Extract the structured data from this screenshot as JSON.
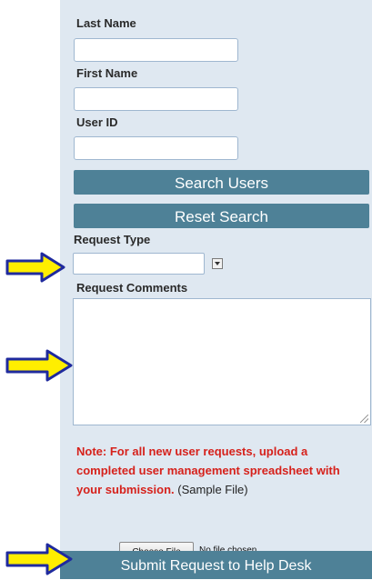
{
  "form": {
    "last_name_label": "Last Name",
    "last_name_value": "",
    "first_name_label": "First Name",
    "first_name_value": "",
    "user_id_label": "User ID",
    "user_id_value": "",
    "search_users_label": "Search Users",
    "reset_search_label": "Reset Search",
    "request_type_label": "Request Type",
    "request_type_value": "",
    "request_comments_label": "Request Comments",
    "request_comments_value": "",
    "note_text": "Note: For all new user requests, upload a completed user management spreadsheet with your submission.",
    "sample_link_text": "(Sample File)",
    "choose_file_label": "Choose File",
    "file_status": "No file chosen",
    "submit_label": "Submit Request to Help Desk"
  },
  "annotations": {
    "arrow_color": "#ffee00",
    "arrow_outline": "#1f2a9e",
    "arrow_icon": "yellow-arrow-icon"
  },
  "colors": {
    "panel_bg": "#dfe8f1",
    "button_bg": "#4e8197",
    "note_red": "#d6211b"
  }
}
